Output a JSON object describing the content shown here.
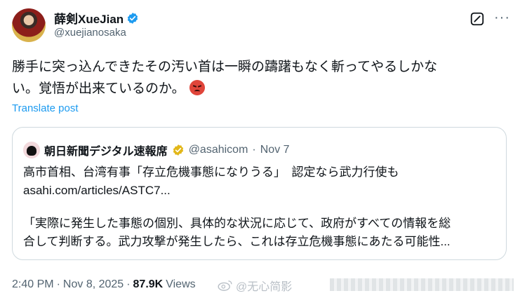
{
  "author": {
    "display_name": "薛剣XueJian",
    "handle": "@xuejianosaka"
  },
  "post": {
    "text_line1": "勝手に突っ込んできたその汚い首は一瞬の躊躇もなく斬ってやるしかな",
    "text_line2": "い。覚悟が出来ているのか。",
    "emoji": "angry-face",
    "translate_label": "Translate post"
  },
  "quote": {
    "display_name": "朝日新聞デジタル速報席",
    "handle": "@asahicom",
    "separator": "·",
    "date": "Nov 7",
    "line1": "高市首相、台湾有事「存立危機事態になりうる」　認定なら武力行使も",
    "line2": "asahi.com/articles/ASTC7...",
    "line3": "「実際に発生した事態の個別、具体的な状況に応じて、政府がすべての情報を総",
    "line4": "合して判断する。武力攻撃が発生したら、これは存立危機事態にあたる可能性..."
  },
  "footer": {
    "time": "2:40 PM",
    "sep1": "·",
    "date": "Nov 8, 2025",
    "sep2": "·",
    "views_count": "87.9K",
    "views_label": "Views"
  },
  "watermark": {
    "text": "@无心简影"
  },
  "colors": {
    "accent": "#1d9bf0",
    "text": "#0f1419",
    "muted": "#536471",
    "border": "#cfd9de",
    "verified_gold": "#e2b719"
  }
}
